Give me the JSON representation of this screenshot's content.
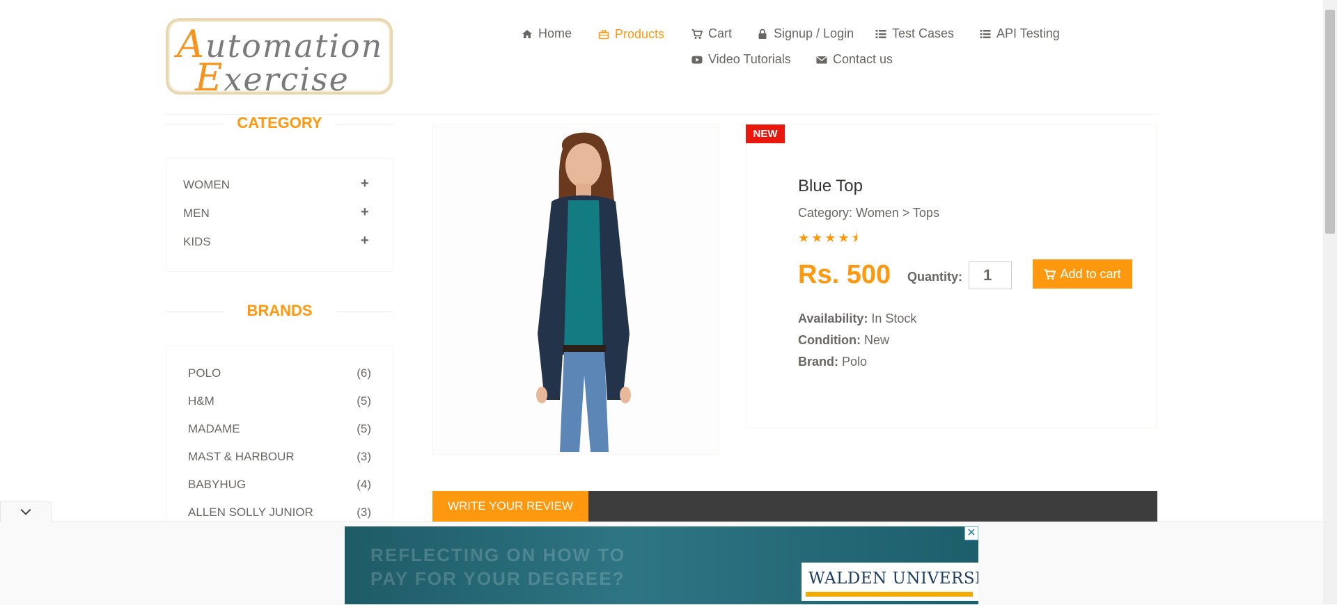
{
  "logo": {
    "line1_cap": "A",
    "line1_rest": "utomation",
    "line2_cap": "E",
    "line2_rest": "xercise"
  },
  "nav": {
    "items": [
      {
        "label": "Home",
        "icon": "home-icon"
      },
      {
        "label": "Products",
        "icon": "briefcase-icon"
      },
      {
        "label": "Cart",
        "icon": "cart-icon"
      },
      {
        "label": "Signup / Login",
        "icon": "lock-icon"
      },
      {
        "label": "Test Cases",
        "icon": "list-icon"
      },
      {
        "label": "API Testing",
        "icon": "list-icon"
      },
      {
        "label": "Video Tutorials",
        "icon": "youtube-icon"
      },
      {
        "label": "Contact us",
        "icon": "envelope-icon"
      }
    ],
    "active_color": "#fe980f"
  },
  "sidebar": {
    "category_title": "CATEGORY",
    "categories": [
      "WOMEN",
      "MEN",
      "KIDS"
    ],
    "expand_symbol": "+",
    "brands_title": "BRANDS",
    "brands": [
      {
        "name": "POLO",
        "count": "(6)"
      },
      {
        "name": "H&M",
        "count": "(5)"
      },
      {
        "name": "MADAME",
        "count": "(5)"
      },
      {
        "name": "MAST & HARBOUR",
        "count": "(3)"
      },
      {
        "name": "BABYHUG",
        "count": "(4)"
      },
      {
        "name": "ALLEN SOLLY JUNIOR",
        "count": "(3)"
      }
    ]
  },
  "product": {
    "badge": "NEW",
    "name": "Blue Top",
    "category": "Category: Women > Tops",
    "rating": 4.5,
    "stars": "★★★★⯨",
    "price": "Rs. 500",
    "quantity_label": "Quantity:",
    "quantity_value": "1",
    "add_to_cart": "Add to cart",
    "availability_label": "Availability:",
    "availability": "In Stock",
    "condition_label": "Condition:",
    "condition": "New",
    "brand_label": "Brand:",
    "brand": "Polo"
  },
  "review": {
    "tab_label": "WRITE YOUR REVIEW"
  },
  "ad": {
    "headline": "REFLECTING ON HOW TO\nPAY FOR YOUR DEGREE?",
    "brand": "WALDEN UNIVERSITY",
    "close": "✕"
  },
  "colors": {
    "accent": "#fe980f",
    "badge": "#e9170c",
    "dark_bar": "#3d3d3d"
  }
}
